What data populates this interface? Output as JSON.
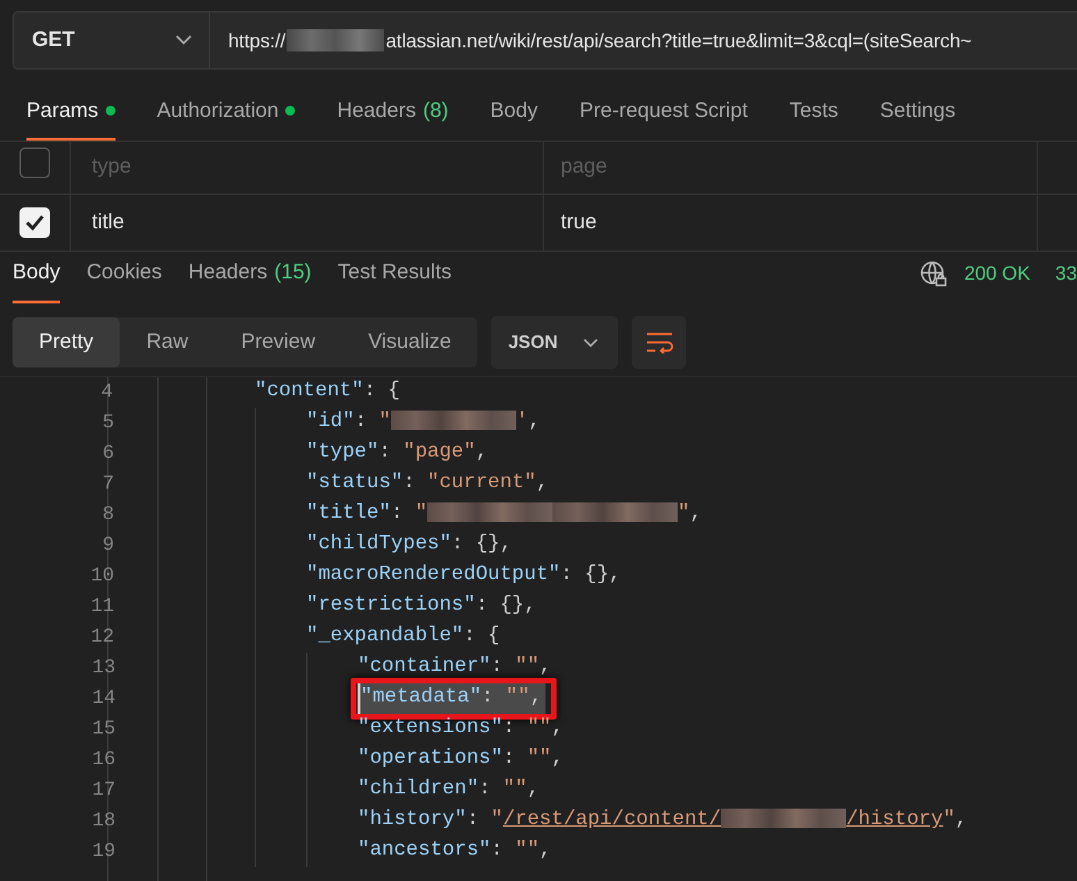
{
  "request": {
    "method": "GET",
    "url_prefix": "https://",
    "url_redacted": true,
    "url_rest": "atlassian.net/wiki/rest/api/search?title=true&limit=3&cql=(siteSearch~"
  },
  "request_tabs": [
    {
      "label": "Params",
      "dot": true,
      "selected": true
    },
    {
      "label": "Authorization",
      "dot": true,
      "selected": false
    },
    {
      "label": "Headers",
      "count": "(8)",
      "dot": false,
      "selected": false
    },
    {
      "label": "Body",
      "dot": false,
      "selected": false
    },
    {
      "label": "Pre-request Script",
      "dot": false,
      "selected": false
    },
    {
      "label": "Tests",
      "dot": false,
      "selected": false
    },
    {
      "label": "Settings",
      "dot": false,
      "selected": false
    }
  ],
  "params": {
    "placeholder_row": {
      "checked": false,
      "key_placeholder": "type",
      "value_placeholder": "page"
    },
    "rows": [
      {
        "checked": true,
        "key": "title",
        "value": "true"
      }
    ]
  },
  "response_tabs": [
    {
      "label": "Body",
      "selected": true
    },
    {
      "label": "Cookies",
      "selected": false
    },
    {
      "label": "Headers",
      "count": "(15)",
      "selected": false
    },
    {
      "label": "Test Results",
      "selected": false
    }
  ],
  "status": {
    "code": "200 OK",
    "size": "33"
  },
  "view_modes": [
    {
      "label": "Pretty",
      "selected": true
    },
    {
      "label": "Raw",
      "selected": false
    },
    {
      "label": "Preview",
      "selected": false
    },
    {
      "label": "Visualize",
      "selected": false
    }
  ],
  "format": "JSON",
  "code": [
    {
      "number": "4",
      "highlighted": false,
      "tokens": [
        {
          "kind": "key",
          "text": "\"content\""
        },
        {
          "kind": "punct",
          "text": ": {"
        }
      ],
      "children": [
        {
          "number": "5",
          "highlighted": false,
          "tokens": [
            {
              "kind": "key",
              "text": "\"id\""
            },
            {
              "kind": "punct",
              "text": ": "
            },
            {
              "kind": "string",
              "text": "\""
            },
            {
              "kind": "redacted"
            },
            {
              "kind": "string",
              "text": "'"
            },
            {
              "kind": "punct",
              "text": ","
            }
          ]
        },
        {
          "number": "6",
          "highlighted": false,
          "tokens": [
            {
              "kind": "key",
              "text": "\"type\""
            },
            {
              "kind": "punct",
              "text": ": "
            },
            {
              "kind": "string",
              "text": "\"page\""
            },
            {
              "kind": "punct",
              "text": ","
            }
          ]
        },
        {
          "number": "7",
          "highlighted": false,
          "tokens": [
            {
              "kind": "key",
              "text": "\"status\""
            },
            {
              "kind": "punct",
              "text": ": "
            },
            {
              "kind": "string",
              "text": "\"current\""
            },
            {
              "kind": "punct",
              "text": ","
            }
          ]
        },
        {
          "number": "8",
          "highlighted": false,
          "tokens": [
            {
              "kind": "key",
              "text": "\"title\""
            },
            {
              "kind": "punct",
              "text": ": "
            },
            {
              "kind": "string",
              "text": "\""
            },
            {
              "kind": "redacted"
            },
            {
              "kind": "redacted"
            },
            {
              "kind": "string",
              "text": "\""
            },
            {
              "kind": "punct",
              "text": ","
            }
          ]
        },
        {
          "number": "9",
          "highlighted": false,
          "tokens": [
            {
              "kind": "key",
              "text": "\"childTypes\""
            },
            {
              "kind": "punct",
              "text": ": {},"
            }
          ]
        },
        {
          "number": "10",
          "highlighted": false,
          "tokens": [
            {
              "kind": "key",
              "text": "\"macroRenderedOutput\""
            },
            {
              "kind": "punct",
              "text": ": {},"
            }
          ]
        },
        {
          "number": "11",
          "highlighted": false,
          "tokens": [
            {
              "kind": "key",
              "text": "\"restrictions\""
            },
            {
              "kind": "punct",
              "text": ": {},"
            }
          ]
        },
        {
          "number": "12",
          "highlighted": false,
          "tokens": [
            {
              "kind": "key",
              "text": "\"_expandable\""
            },
            {
              "kind": "punct",
              "text": ": {"
            }
          ],
          "children": [
            {
              "number": "13",
              "highlighted": false,
              "tokens": [
                {
                  "kind": "key",
                  "text": "\"container\""
                },
                {
                  "kind": "punct",
                  "text": ": "
                },
                {
                  "kind": "string",
                  "text": "\"\""
                },
                {
                  "kind": "punct",
                  "text": ","
                }
              ]
            },
            {
              "number": "14",
              "highlighted": true,
              "tokens": [
                {
                  "kind": "key",
                  "text": "\"metadata\""
                },
                {
                  "kind": "punct",
                  "text": ": "
                },
                {
                  "kind": "string",
                  "text": "\"\""
                },
                {
                  "kind": "punct",
                  "text": ","
                }
              ]
            },
            {
              "number": "15",
              "highlighted": false,
              "tokens": [
                {
                  "kind": "key",
                  "text": "\"extensions\""
                },
                {
                  "kind": "punct",
                  "text": ": "
                },
                {
                  "kind": "string",
                  "text": "\"\""
                },
                {
                  "kind": "punct",
                  "text": ","
                }
              ]
            },
            {
              "number": "16",
              "highlighted": false,
              "tokens": [
                {
                  "kind": "key",
                  "text": "\"operations\""
                },
                {
                  "kind": "punct",
                  "text": ": "
                },
                {
                  "kind": "string",
                  "text": "\"\""
                },
                {
                  "kind": "punct",
                  "text": ","
                }
              ]
            },
            {
              "number": "17",
              "highlighted": false,
              "tokens": [
                {
                  "kind": "key",
                  "text": "\"children\""
                },
                {
                  "kind": "punct",
                  "text": ": "
                },
                {
                  "kind": "string",
                  "text": "\"\""
                },
                {
                  "kind": "punct",
                  "text": ","
                }
              ]
            },
            {
              "number": "18",
              "highlighted": false,
              "tokens": [
                {
                  "kind": "key",
                  "text": "\"history\""
                },
                {
                  "kind": "punct",
                  "text": ": "
                },
                {
                  "kind": "string",
                  "text": "\""
                },
                {
                  "kind": "link",
                  "text": "/rest/api/content/"
                },
                {
                  "kind": "redacted"
                },
                {
                  "kind": "link",
                  "text": "/history"
                },
                {
                  "kind": "string",
                  "text": "\""
                },
                {
                  "kind": "punct",
                  "text": ","
                }
              ]
            },
            {
              "number": "19",
              "highlighted": false,
              "tokens": [
                {
                  "kind": "key",
                  "text": "\"ancestors\""
                },
                {
                  "kind": "punct",
                  "text": ": "
                },
                {
                  "kind": "string",
                  "text": "\"\""
                },
                {
                  "kind": "punct",
                  "text": ","
                }
              ]
            }
          ]
        }
      ]
    }
  ]
}
